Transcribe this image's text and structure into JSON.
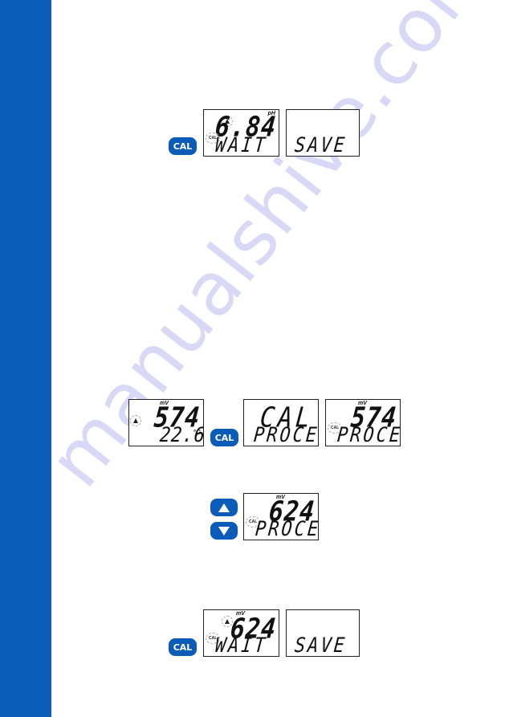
{
  "watermark": "manualshive.com",
  "colors": {
    "sidebar": "#0a5cb8",
    "button": "#0a5cb8"
  },
  "section1": {
    "button": {
      "label": "CAL",
      "icon": "cal-button"
    },
    "lcd_wait": {
      "unit": "pH",
      "value": "6.84",
      "message": "WAIT",
      "cal_flag": "CAL",
      "stability_flag": "stability-icon"
    },
    "lcd_save": {
      "message": "SAVE"
    }
  },
  "section2": {
    "lcd_measure": {
      "unit": "mV",
      "value": "574",
      "temperature": "22.6",
      "temp_unit": "°C",
      "stability_flag": "stability-icon"
    },
    "button": {
      "label": "CAL"
    },
    "lcd_cal": {
      "value": "CAL",
      "message": "PROCE"
    },
    "lcd_proce": {
      "unit": "mV",
      "value": "574",
      "message": "PROCE",
      "cal_flag": "CAL"
    }
  },
  "section3": {
    "up_button": {
      "icon": "arrow-up-icon"
    },
    "down_button": {
      "icon": "arrow-down-icon"
    },
    "lcd_adjust": {
      "unit": "mV",
      "value": "624",
      "message": "PROCE",
      "cal_flag": "CAL"
    }
  },
  "section4": {
    "button": {
      "label": "CAL"
    },
    "lcd_wait": {
      "unit": "mV",
      "value": "624",
      "message": "WAIT",
      "cal_flag": "CAL",
      "stability_flag": "stability-icon"
    },
    "lcd_save": {
      "message": "SAVE"
    }
  }
}
